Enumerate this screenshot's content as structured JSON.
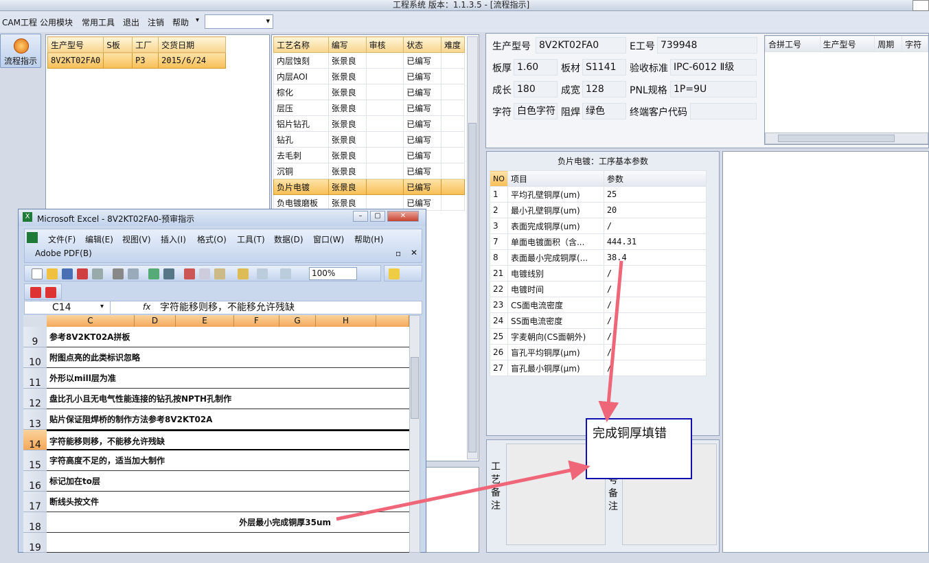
{
  "app": {
    "title": "工程系统   版本：1.1.3.5 - [流程指示]"
  },
  "menu": [
    "CAM工程",
    "公用模块",
    "常用工具",
    "退出",
    "注销",
    "帮助"
  ],
  "left_button": "流程指示",
  "order_table": {
    "headers": [
      "生产型号",
      "S板",
      "工厂",
      "交货日期"
    ],
    "rows": [
      [
        "8V2KT02FA0",
        "",
        "P3",
        "2015/6/24"
      ]
    ]
  },
  "process_table": {
    "headers": [
      "工艺名称",
      "编写",
      "审核",
      "状态",
      "难度"
    ],
    "rows": [
      [
        "内层蚀刻",
        "张景良",
        "",
        "已编写",
        ""
      ],
      [
        "内层AOI",
        "张景良",
        "",
        "已编写",
        ""
      ],
      [
        "棕化",
        "张景良",
        "",
        "已编写",
        ""
      ],
      [
        "层压",
        "张景良",
        "",
        "已编写",
        ""
      ],
      [
        "铝片钻孔",
        "张景良",
        "",
        "已编写",
        ""
      ],
      [
        "钻孔",
        "张景良",
        "",
        "已编写",
        ""
      ],
      [
        "去毛刺",
        "张景良",
        "",
        "已编写",
        ""
      ],
      [
        "沉铜",
        "张景良",
        "",
        "已编写",
        ""
      ],
      [
        "负片电镀",
        "张景良",
        "",
        "已编写",
        ""
      ],
      [
        "负电镀磨板",
        "张景良",
        "",
        "已编写",
        ""
      ]
    ]
  },
  "info": {
    "model_label": "生产型号",
    "model": "8V2KT02FA0",
    "e_label": "E工号",
    "e_no": "739948",
    "thick_label": "板厚",
    "thick": "1.60",
    "mat_label": "板材",
    "mat": "S1141",
    "std_label": "验收标准",
    "std": "IPC-6012 Ⅱ级",
    "len_label": "成长",
    "len": "180",
    "wid_label": "成宽",
    "wid": "128",
    "pnl_label": "PNL规格",
    "pnl": "1P=9U",
    "char_label": "字符",
    "char": "白色字符",
    "mask_label": "阻焊",
    "mask": "绿色",
    "cust_label": "终端客户代码",
    "cust": ""
  },
  "merge_table": {
    "headers": [
      "合拼工号",
      "生产型号",
      "周期",
      "字符"
    ]
  },
  "params": {
    "title": "负片电镀：工序基本参数",
    "headers": [
      "NO",
      "项目",
      "参数"
    ],
    "rows": [
      [
        "1",
        "平均孔壁铜厚(um)",
        "25"
      ],
      [
        "2",
        "最小孔壁铜厚(um)",
        "20"
      ],
      [
        "3",
        "表面完成铜厚(um)",
        "/"
      ],
      [
        "7",
        "单面电镀面积（含...",
        "444.31"
      ],
      [
        "8",
        "表面最小完成铜厚(...",
        "38.4"
      ],
      [
        "21",
        "电镀线别",
        "/"
      ],
      [
        "22",
        "电镀时间",
        "/"
      ],
      [
        "23",
        "CS面电流密度",
        "/"
      ],
      [
        "24",
        "SS面电流密度",
        "/"
      ],
      [
        "25",
        "字麦朝向(CS面朝外)",
        "/"
      ],
      [
        "26",
        "盲孔平均铜厚(μm)",
        "/"
      ],
      [
        "27",
        "盲孔最小铜厚(μm)",
        "/"
      ]
    ]
  },
  "remarks": {
    "process": "工艺备注",
    "other": "号备注"
  },
  "annotation": "完成铜厚填错",
  "excel": {
    "title": "Microsoft Excel - 8V2KT02FA0-预审指示",
    "menu": [
      "文件(F)",
      "编辑(E)",
      "视图(V)",
      "插入(I)",
      "格式(O)",
      "工具(T)",
      "数据(D)",
      "窗口(W)",
      "帮助(H)"
    ],
    "addon": "Adobe PDF(B)",
    "zoom": "100%",
    "namebox": "C14",
    "fx": "fx",
    "formula": "字符能移则移，不能移允许残缺",
    "cols": [
      "C",
      "D",
      "E",
      "F",
      "G",
      "H"
    ],
    "rows": [
      {
        "n": "9",
        "text": "参考8V2KT02A拼板"
      },
      {
        "n": "10",
        "text": "附图点亮的此类标识忽略"
      },
      {
        "n": "11",
        "text": "外形以mill层为准"
      },
      {
        "n": "12",
        "text": "盘比孔小且无电气性能连接的钻孔按NPTH孔制作"
      },
      {
        "n": "13",
        "text": "贴片保证阻焊桥的制作方法参考8V2KT02A"
      },
      {
        "n": "14",
        "text": "字符能移则移，不能移允许残缺"
      },
      {
        "n": "15",
        "text": "字符高度不足的，适当加大制作"
      },
      {
        "n": "16",
        "text": "标记加在to层"
      },
      {
        "n": "17",
        "text": "断线头按文件"
      },
      {
        "n": "18",
        "text": "外层最小完成铜厚35um"
      },
      {
        "n": "19",
        "text": ""
      }
    ]
  }
}
